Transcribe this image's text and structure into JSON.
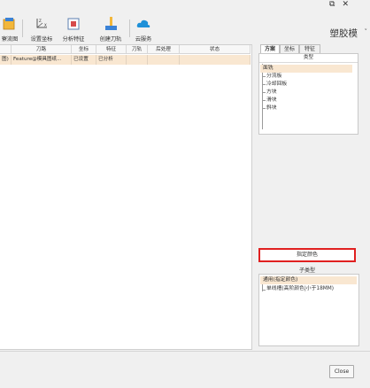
{
  "window": {
    "restore_glyph": "⧉",
    "close_glyph": "✕"
  },
  "ribbon": {
    "buttons": [
      {
        "label": "寮流图",
        "icon": "drawing-icon"
      },
      {
        "label": "设置坐标",
        "icon": "coordinate-icon"
      },
      {
        "label": "分析特征",
        "icon": "analyze-icon"
      },
      {
        "label": "创建刀轨",
        "icon": "toolpath-icon"
      },
      {
        "label": "云服务",
        "icon": "cloud-icon"
      }
    ],
    "app_title": "塑胶模",
    "app_title_chevron": "˅"
  },
  "table": {
    "columns": [
      "",
      "刀路",
      "坐标",
      "特征",
      "刀轨",
      "后处理",
      "状态"
    ],
    "rows": [
      {
        "cells": [
          "图)",
          "Feature@模具图纸...",
          "已设置",
          "已分析",
          "",
          "",
          ""
        ]
      }
    ]
  },
  "right_panel": {
    "tabs": [
      "方案",
      "坐标",
      "特征"
    ],
    "type_header": "类型",
    "type_items": [
      "面铣",
      "分流板",
      "冷却回板",
      "方块",
      "滑块",
      "斜块"
    ],
    "specify_button": "指定颜色",
    "subtype_header": "子类型",
    "subtype_items": [
      "通用(指定颜色)",
      "单线槽(高阶颜色|小于18MM)"
    ]
  },
  "bottom": {
    "close_label": "Close"
  },
  "colors": {
    "selection": "#f9e7d1",
    "highlight_border": "#e02020",
    "cloud": "#1e90d8"
  }
}
